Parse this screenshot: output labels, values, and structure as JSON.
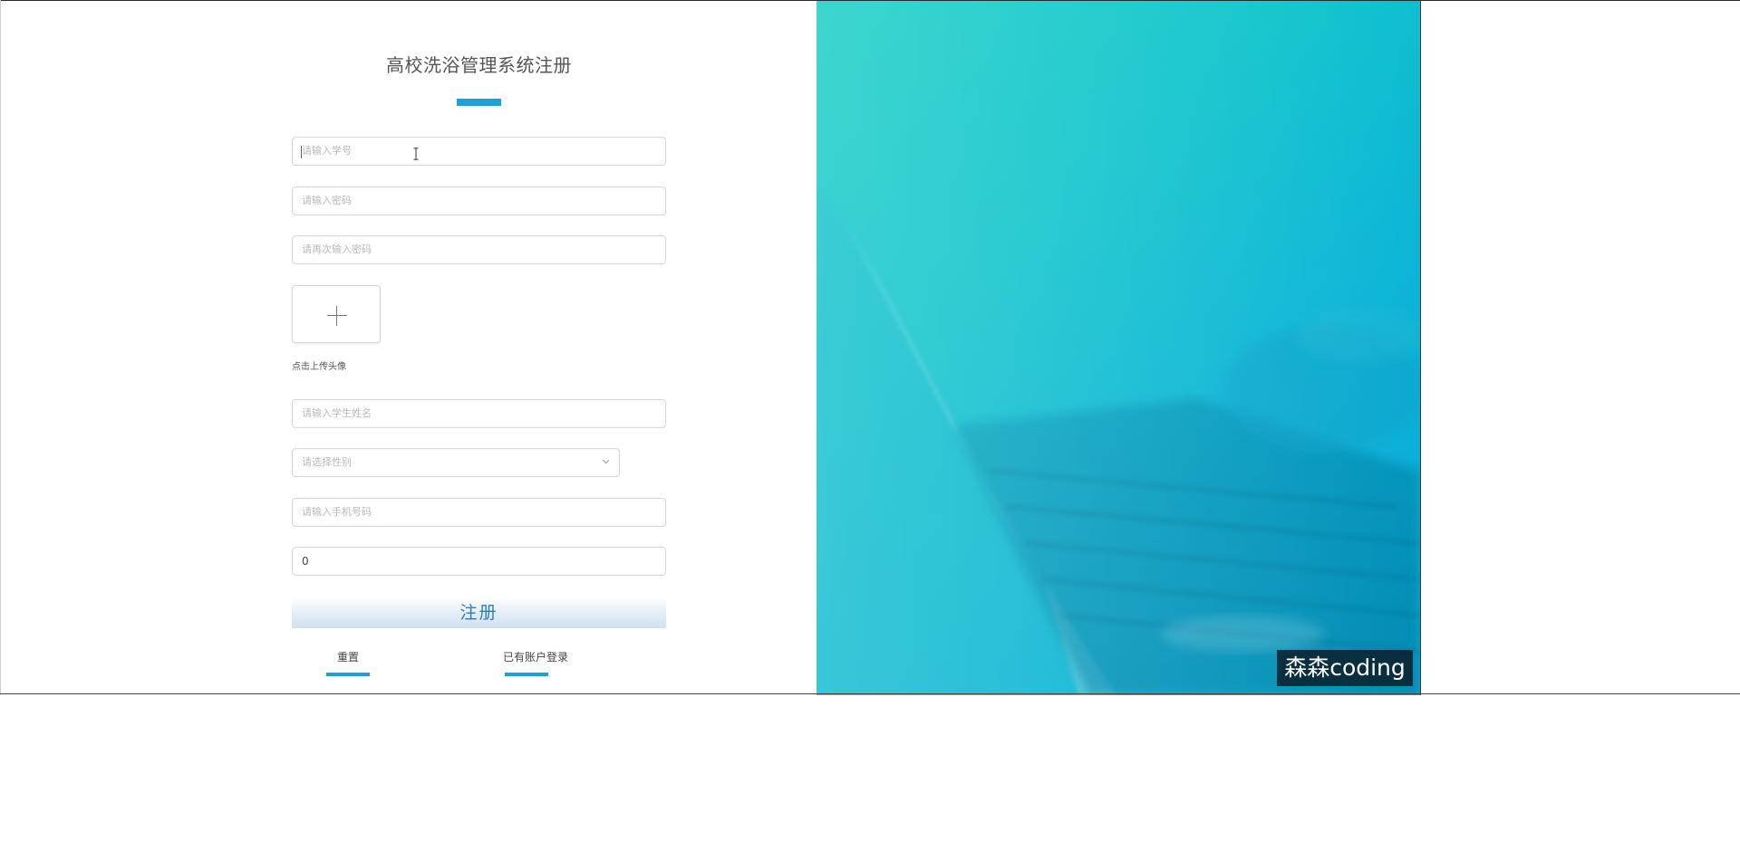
{
  "form": {
    "title": "高校洗浴管理系统注册",
    "student_id": {
      "placeholder": "请输入学号"
    },
    "password": {
      "placeholder": "请输入密码"
    },
    "confirm_password": {
      "placeholder": "请再次输入密码"
    },
    "avatar": {
      "hint": "点击上传头像",
      "icon": "plus-icon"
    },
    "student_name": {
      "placeholder": "请输入学生姓名"
    },
    "gender": {
      "placeholder": "请选择性别",
      "icon": "chevron-down-icon"
    },
    "phone": {
      "placeholder": "请输入手机号码"
    },
    "balance": {
      "value": "0"
    },
    "submit_label": "注册",
    "reset_label": "重置",
    "login_link_label": "已有账户登录"
  },
  "watermark": {
    "text": "森森coding"
  },
  "colors": {
    "accent": "#1ea0da",
    "hero_start": "#12cdc4",
    "hero_end": "#0aa8da",
    "button_text": "#2a7cc4"
  }
}
